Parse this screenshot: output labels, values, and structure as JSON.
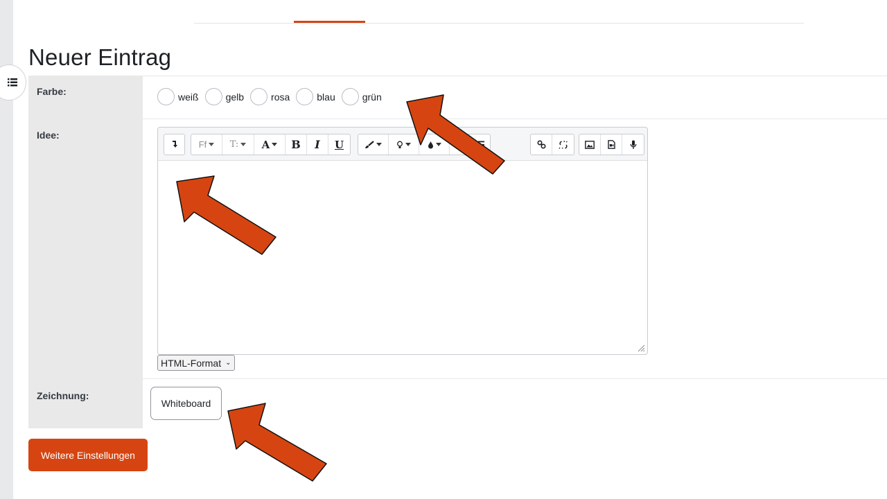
{
  "page": {
    "title": "Neuer Eintrag"
  },
  "form": {
    "farbe": {
      "label": "Farbe:",
      "options": [
        "weiß",
        "gelb",
        "rosa",
        "blau",
        "grün"
      ]
    },
    "idee": {
      "label": "Idee:",
      "format_select": "HTML-Format",
      "toolbar": {
        "font_family_btn": "Ff",
        "font_size_btn": "T:",
        "text_style_btn": "A",
        "bold": "B",
        "italic": "I",
        "underline": "U"
      }
    },
    "zeichnung": {
      "label": "Zeichnung:",
      "button": "Whiteboard"
    }
  },
  "actions": {
    "more_settings": "Weitere Einstellungen"
  },
  "colors": {
    "accent": "#d64511",
    "label_bg": "#e9e9ea",
    "arrow": "#d64511"
  },
  "icons": [
    "list-icon",
    "undo-icon",
    "brush-icon",
    "lightbulb-icon",
    "drop-icon",
    "ordered-list-icon",
    "link-icon",
    "unlink-icon",
    "image-icon",
    "media-icon",
    "microphone-icon"
  ]
}
